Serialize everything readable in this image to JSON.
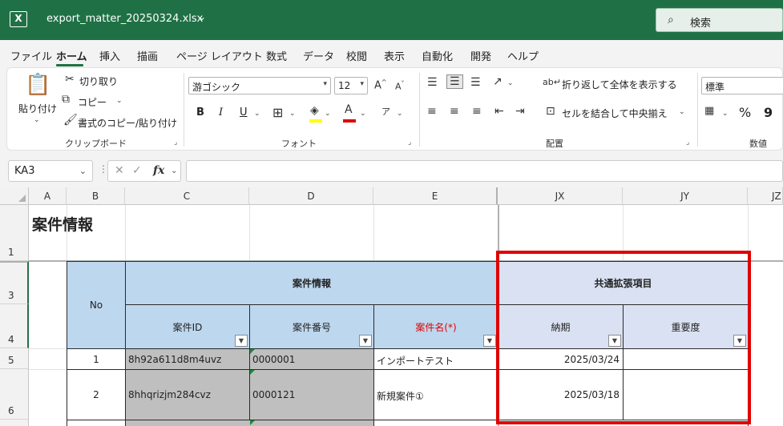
{
  "titlebar": {
    "app_logo": "excel-logo",
    "filename": "export_matter_20250324.xlsx",
    "search_label": "検索",
    "accent_color": "#1f7145"
  },
  "menu": {
    "items": [
      "ファイル",
      "ホーム",
      "挿入",
      "描画",
      "ページ レイアウト",
      "数式",
      "データ",
      "校閲",
      "表示",
      "自動化",
      "開発",
      "ヘルプ"
    ],
    "active": "ホーム"
  },
  "ribbon": {
    "clipboard": {
      "paste": "貼り付け",
      "cut": "切り取り",
      "copy": "コピー",
      "format_painter": "書式のコピー/貼り付け",
      "group_label": "クリップボード"
    },
    "font": {
      "font_name": "游ゴシック",
      "font_size": "12",
      "bold": "B",
      "italic": "I",
      "underline": "U",
      "group_label": "フォント"
    },
    "alignment": {
      "wrap_text": "折り返して全体を表示する",
      "merge_center": "セルを結合して中央揃え",
      "group_label": "配置"
    },
    "number": {
      "format": "標準",
      "percent": "%",
      "comma": "9",
      "group_label": "数値"
    }
  },
  "formula_bar": {
    "name_box": "KA3",
    "fx": "fx",
    "content": ""
  },
  "grid": {
    "columns": [
      "A",
      "B",
      "C",
      "D",
      "E",
      "JX",
      "JY",
      "JZ"
    ],
    "rows": [
      "1",
      "3",
      "4",
      "5",
      "6"
    ],
    "sheet_title": "案件情報",
    "table": {
      "no_header": "No",
      "group_header": "案件情報",
      "ext_header": "共通拡張項目",
      "col_id": "案件ID",
      "col_number": "案件番号",
      "col_name": "案件名(*)",
      "col_due": "納期",
      "col_priority": "重要度",
      "data_rows": [
        {
          "no": "1",
          "id": "8h92a611d8m4uvz",
          "number": "0000001",
          "name": "インポートテスト",
          "due": "2025/03/24",
          "priority": ""
        },
        {
          "no": "2",
          "id": "8hhqrizjm284cvz",
          "number": "0000121",
          "name": "新規案件①",
          "due": "2025/03/18",
          "priority": ""
        }
      ]
    },
    "highlight_color": "#e00000"
  }
}
